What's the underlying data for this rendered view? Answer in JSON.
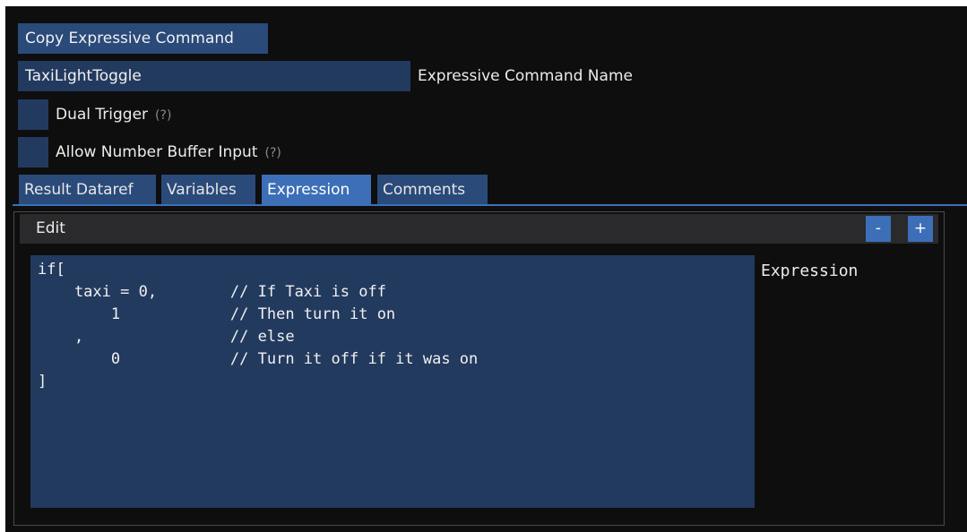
{
  "toolbar": {
    "copy_button": "Copy Expressive Command"
  },
  "command_name": {
    "value": "TaxiLightToggle",
    "label": "Expressive Command Name"
  },
  "options": [
    {
      "label": "Dual Trigger",
      "help": "(?)"
    },
    {
      "label": "Allow Number Buffer Input",
      "help": "(?)"
    }
  ],
  "tabs": [
    {
      "label": "Result Dataref"
    },
    {
      "label": "Variables"
    },
    {
      "label": "Expression",
      "active": true
    },
    {
      "label": "Comments"
    }
  ],
  "panel": {
    "title": "Edit",
    "minus": "-",
    "plus": "+"
  },
  "editor": {
    "code": "if[\n    taxi = 0,        // If Taxi is off\n        1            // Then turn it on\n    ,                // else\n        0            // Turn it off if it was on\n]",
    "label": "Expression"
  }
}
